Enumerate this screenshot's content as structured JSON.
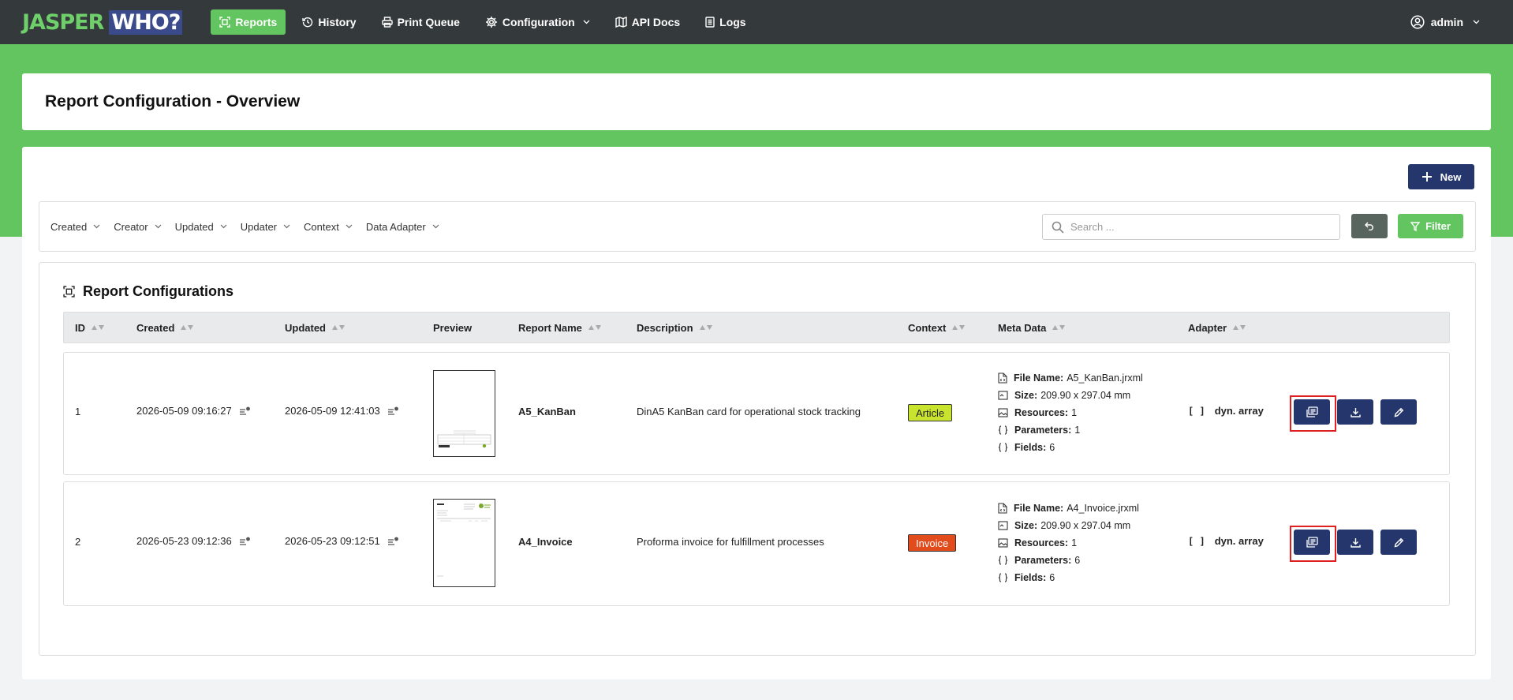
{
  "app": {
    "logo_part1": "JASPER",
    "logo_part2": "WHO?"
  },
  "nav": {
    "items": [
      {
        "label": "Reports",
        "icon": "report-frame-icon",
        "active": true
      },
      {
        "label": "History",
        "icon": "history-icon"
      },
      {
        "label": "Print Queue",
        "icon": "printer-icon"
      },
      {
        "label": "Configuration",
        "icon": "gear-icon",
        "dropdown": true
      },
      {
        "label": "API Docs",
        "icon": "book-map-icon"
      },
      {
        "label": "Logs",
        "icon": "list-document-icon"
      }
    ],
    "user": "admin"
  },
  "page": {
    "title": "Report Configuration - Overview"
  },
  "toolbar": {
    "new_label": "New",
    "filters": [
      "Created",
      "Creator",
      "Updated",
      "Updater",
      "Context",
      "Data Adapter"
    ],
    "search_placeholder": "Search ...",
    "filter_label": "Filter"
  },
  "table": {
    "title": "Report Configurations",
    "columns": [
      "ID",
      "Created",
      "Updated",
      "Preview",
      "Report Name",
      "Description",
      "Context",
      "Meta Data",
      "Adapter"
    ],
    "meta_labels": {
      "file_name": "File Name:",
      "size": "Size:",
      "resources": "Resources:",
      "parameters": "Parameters:",
      "fields": "Fields:"
    },
    "rows": [
      {
        "id": "1",
        "created": "2026-05-09 09:16:27",
        "updated": "2026-05-09 12:41:03",
        "report_name": "A5_KanBan",
        "description": "DinA5 KanBan card for operational stock tracking",
        "context": "Article",
        "file_name": "A5_KanBan.jrxml",
        "size": "209.90 x 297.04 mm",
        "resources": "1",
        "parameters": "1",
        "fields": "6",
        "adapter_symbol": "[ ]",
        "adapter": "dyn. array"
      },
      {
        "id": "2",
        "created": "2026-05-23 09:12:36",
        "updated": "2026-05-23 09:12:51",
        "report_name": "A4_Invoice",
        "description": "Proforma invoice for fulfillment processes",
        "context": "Invoice",
        "file_name": "A4_Invoice.jrxml",
        "size": "209.90 x 297.04 mm",
        "resources": "1",
        "parameters": "6",
        "fields": "6",
        "adapter_symbol": "[ ]",
        "adapter": "dyn. array"
      }
    ]
  },
  "colors": {
    "navbar": "#343a3b",
    "brand_green": "#62c560",
    "primary_navy": "#24366b",
    "article_badge": "#c9e42e",
    "invoice_badge": "#e24b1c",
    "highlight": "#e02020"
  }
}
